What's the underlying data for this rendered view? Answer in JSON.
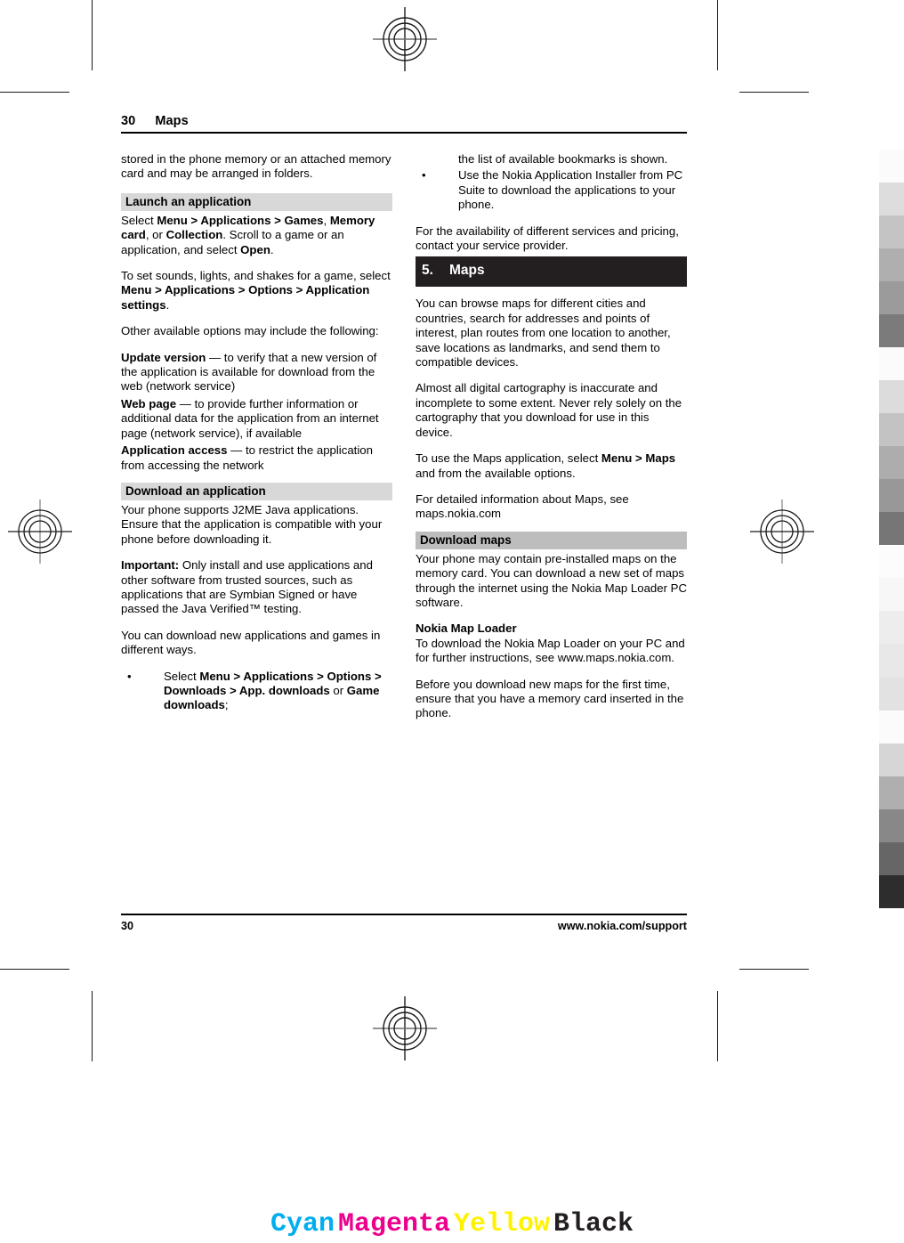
{
  "page": {
    "header_number": "30",
    "header_title": "Maps",
    "footer_number": "30",
    "footer_url": "www.nokia.com/support"
  },
  "left_column": {
    "continued_paragraph": "stored in the phone memory or an attached memory card and may be arranged in folders.",
    "launch_section": {
      "heading": "Launch an application",
      "p1_a": "Select ",
      "p1_menu": "Menu",
      "p1_gt1": " > ",
      "p1_applications": "Applications",
      "p1_gt2": " > ",
      "p1_games": "Games",
      "p1_comma": ", ",
      "p1_memory_card": "Memory card",
      "p1_or": ", or ",
      "p1_collection": "Collection",
      "p1_b": ". Scroll to a game or an application, and select ",
      "p1_open": "Open",
      "p1_end": ".",
      "p2_a": "To set sounds, lights, and shakes for a game, select ",
      "p2_menu": "Menu",
      "p2_gt1": " > ",
      "p2_applications": "Applications",
      "p2_gt2": " > ",
      "p2_options": "Options",
      "p2_gt3": " > ",
      "p2_appsettings": "Application settings",
      "p2_end": ".",
      "p3": "Other available options may include the following:"
    },
    "definitions": [
      {
        "term": "Update version",
        "dash": "  — ",
        "desc": "to verify that a new version of the application is available for download from the web (network service)"
      },
      {
        "term": "Web page",
        "dash": " —  ",
        "desc": "to provide further information or additional data for the application from an internet page (network service), if available"
      },
      {
        "term": "Application access",
        "dash": " —  ",
        "desc": "to restrict the application from accessing the network"
      }
    ],
    "download_section": {
      "heading": "Download an application",
      "p1": "Your phone supports J2ME Java applications. Ensure that the application is compatible with your phone before downloading it.",
      "important_label": "Important:",
      "important_text": "  Only install and use applications and other software from trusted sources, such as applications that are Symbian Signed or have passed the Java Verified™ testing.",
      "p2": "You can download new applications and games in different ways.",
      "bullet1_a": "Select ",
      "bullet1_menu": "Menu",
      "bullet1_gt1": " > ",
      "bullet1_applications": "Applications",
      "bullet1_gt2": " > ",
      "bullet1_options": "Options",
      "bullet1_gt3": " > ",
      "bullet1_downloads": "Downloads",
      "bullet1_gt4": " > ",
      "bullet1_appdownloads": "App. downloads",
      "bullet1_or": " or ",
      "bullet1_gamedownloads": "Game downloads",
      "bullet1_end": ";"
    }
  },
  "right_column": {
    "bullet_continued": "the list of available bookmarks is shown.",
    "bullet2": "Use the Nokia Application Installer from PC Suite to download the applications to your phone.",
    "availability_para": "For the availability of different services and pricing, contact your service provider.",
    "chapter": {
      "number": "5.",
      "title": "Maps"
    },
    "intro1": "You can browse maps for different cities and countries, search for addresses and points of interest, plan routes from one location to another, save locations as landmarks, and send them to compatible devices.",
    "intro2": "Almost all digital cartography is inaccurate and incomplete to some extent. Never rely solely on the cartography that you download for use in this device.",
    "use_a": "To use the Maps application, select ",
    "use_menu": "Menu",
    "use_gt": " > ",
    "use_maps": "Maps",
    "use_b": " and from the available options.",
    "detail_info": "For detailed information about Maps, see maps.nokia.com",
    "download_maps": {
      "heading": "Download maps",
      "p1": "Your phone may contain pre-installed maps on the memory card. You can download a new set of maps through the internet using the Nokia Map Loader PC software.",
      "sub_heading": "Nokia Map Loader",
      "p2": "To download the Nokia Map Loader on your PC and for further instructions, see www.maps.nokia.com.",
      "p3": "Before you download new maps for the first time, ensure that you have a memory card inserted in the phone."
    }
  },
  "color_bar": {
    "cyan": "Cyan",
    "magenta": "Magenta",
    "yellow": "Yellow",
    "black": "Black",
    "cyan_hex": "#00AEEF",
    "magenta_hex": "#EC008C",
    "yellow_hex": "#FFF200",
    "black_hex": "#231F20"
  },
  "gray_strip": {
    "steps": [
      "#fbfbfb",
      "#dddddd",
      "#c4c4c4",
      "#afafaf",
      "#9b9b9b",
      "#7b7b7b",
      "#fbfbfb",
      "#dcdcdc",
      "#c3c3c3",
      "#adadad",
      "#989898",
      "#767676",
      "#fcfcfc",
      "#f7f7f7",
      "#ededed",
      "#e8e8e8",
      "#e2e2e2",
      "#fbfbfb",
      "#d6d6d6",
      "#afafaf",
      "#888888",
      "#666666",
      "#2d2d2d"
    ]
  }
}
